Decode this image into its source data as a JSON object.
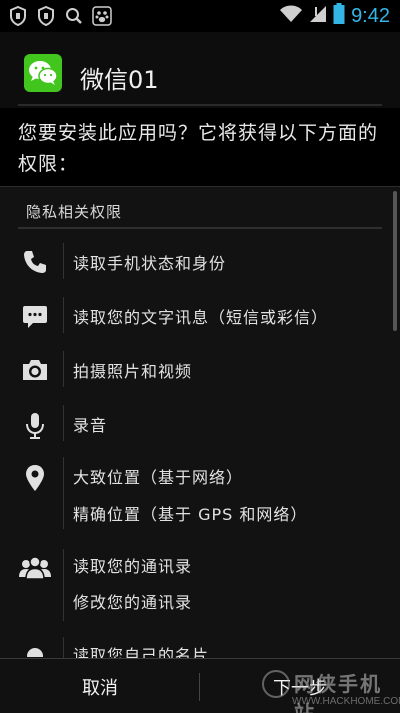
{
  "status_bar": {
    "time": "9:42",
    "icons": [
      "shield-icon",
      "shield-icon",
      "search-icon",
      "baidu-paw-icon",
      "wifi-icon",
      "signal-icon",
      "battery-icon"
    ],
    "accent": "#33b5e5"
  },
  "app": {
    "name": "微信01",
    "icon": "wechat-icon",
    "icon_color": "#42c51c"
  },
  "question": "您要安装此应用吗？它将获得以下方面的权限：",
  "section_title": "隐私相关权限",
  "permissions": [
    {
      "icon": "phone-icon",
      "lines": [
        "读取手机状态和身份"
      ]
    },
    {
      "icon": "message-icon",
      "lines": [
        "读取您的文字讯息（短信或彩信）"
      ]
    },
    {
      "icon": "camera-icon",
      "lines": [
        "拍摄照片和视频"
      ]
    },
    {
      "icon": "microphone-icon",
      "lines": [
        "录音"
      ]
    },
    {
      "icon": "location-pin-icon",
      "lines": [
        "大致位置（基于网络）",
        "精确位置（基于 GPS 和网络）"
      ]
    },
    {
      "icon": "contacts-icon",
      "lines": [
        "读取您的通讯录",
        "修改您的通讯录"
      ]
    },
    {
      "icon": "profile-icon",
      "lines": [
        "读取您自己的名片"
      ]
    }
  ],
  "buttons": {
    "cancel": "取消",
    "next": "下一步"
  },
  "watermark": {
    "main": "网侠手机站",
    "sub": "WWW.HACKHOME.COM"
  }
}
